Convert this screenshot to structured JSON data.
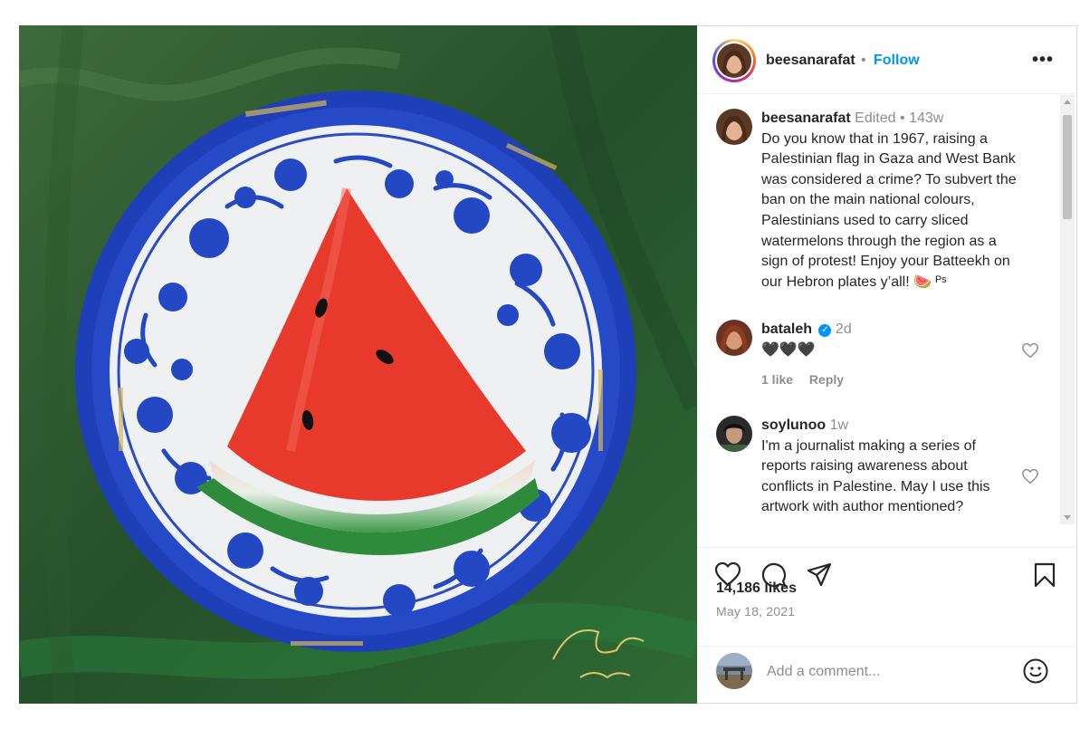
{
  "post": {
    "image_alt": "Painting of a watermelon slice on a blue and white Hebron ceramic plate on a green background"
  },
  "header": {
    "username": "beesanarafat",
    "separator": "•",
    "follow_label": "Follow",
    "more_icon": "more-horizontal-icon",
    "more_label": "•••"
  },
  "caption": {
    "username": "beesanarafat",
    "edited": "Edited",
    "dot": "•",
    "time": "143w",
    "lines": [
      "Do you know that in 1967, raising a",
      "Palestinian flag in Gaza and West Bank",
      "was considered a crime? To subvert the",
      "ban on the main national colours,",
      "Palestinians used to carry sliced",
      "watermelons through the region as a",
      "sign of protest! Enjoy your Batteekh on",
      "our Hebron plates y’all! 🍉 ᴾˢ"
    ]
  },
  "comments": [
    {
      "username": "bataleh",
      "verified": true,
      "time": "2d",
      "text": "🖤🖤🖤",
      "likes": "1 like",
      "reply_label": "Reply"
    },
    {
      "username": "soylunoo",
      "verified": false,
      "time": "1w",
      "lines": [
        "I'm a journalist making a series of",
        "reports raising awareness about",
        "conflicts in Palestine. May I use this",
        "artwork with author mentioned?"
      ]
    }
  ],
  "actions": {
    "like_icon": "heart-icon",
    "comment_icon": "comment-icon",
    "share_icon": "send-icon",
    "save_icon": "bookmark-icon"
  },
  "likes_text": "14,186 likes",
  "date_text": "May 18, 2021",
  "add_comment": {
    "placeholder": "Add a comment...",
    "emoji_icon": "smiley-icon"
  },
  "colors": {
    "accent": "#0095f6",
    "text": "#262626",
    "muted": "#8e8e8e",
    "border": "#dbdbdb"
  }
}
